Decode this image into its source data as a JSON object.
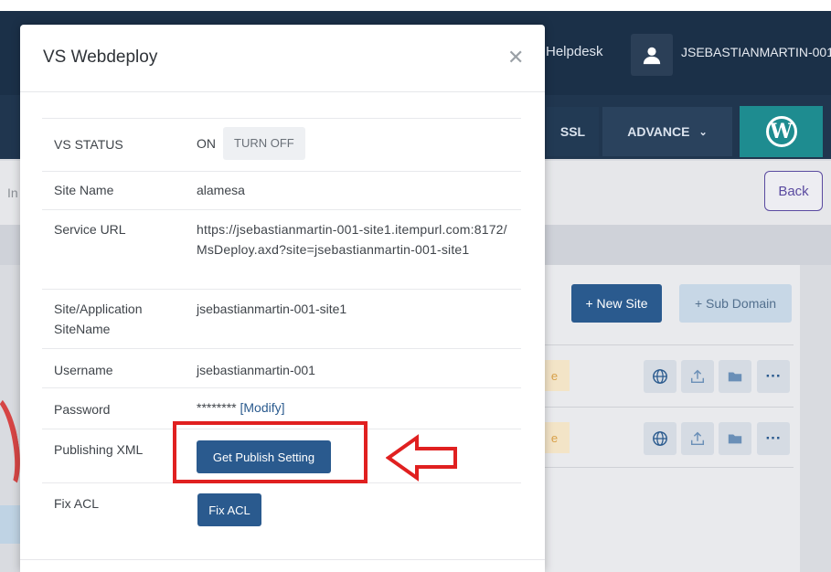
{
  "header": {
    "helpdesk": "Helpdesk",
    "username": "JSEBASTIANMARTIN-001"
  },
  "nav": {
    "ssl": "SSL",
    "advance": "ADVANCE",
    "wordpress_icon": "wordpress-icon"
  },
  "page": {
    "back": "Back",
    "left_fragment": "In",
    "new_site": "+ New Site",
    "sub_domain": "+ Sub Domain",
    "status_fragment": "e"
  },
  "modal": {
    "title": "VS Webdeploy",
    "close_icon": "close-icon",
    "rows": [
      {
        "label": "VS STATUS",
        "value": "ON",
        "action": "TURN OFF"
      },
      {
        "label": "Site Name",
        "value": "alamesa"
      },
      {
        "label": "Service URL",
        "value": "https://jsebastianmartin-001-site1.itempurl.com:8172/MsDeploy.axd?site=jsebastianmartin-001-site1"
      },
      {
        "label": "Site/Application SiteName",
        "value": "jsebastianmartin-001-site1"
      },
      {
        "label": "Username",
        "value": "jsebastianmartin-001"
      },
      {
        "label": "Password",
        "value": "********",
        "link": "[Modify]"
      },
      {
        "label": "Publishing XML",
        "button": "Get Publish Setting"
      },
      {
        "label": "Fix ACL",
        "button": "Fix ACL"
      }
    ]
  },
  "colors": {
    "header_bg": "#1b3048",
    "primary": "#2a5a8e",
    "highlight": "#e02020",
    "wordpress_bg": "#1e8c90"
  }
}
